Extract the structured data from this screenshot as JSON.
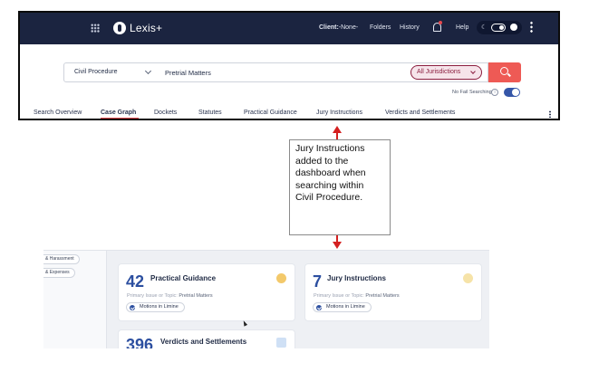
{
  "top_screen": {
    "nav": {
      "logo": "Lexis+",
      "client_label": "Client:",
      "client_value": "-None-",
      "folders": "Folders",
      "history": "History",
      "help": "Help"
    },
    "search": {
      "scope": "Civil Procedure",
      "query": "Pretrial Matters",
      "jurisdiction": "All Jurisdictions",
      "no_fail_label": "No Fail Searching",
      "no_fail_enabled": true
    },
    "tabs": [
      {
        "label": "Search Overview"
      },
      {
        "label": "Case Graph",
        "active": true
      },
      {
        "label": "Dockets"
      },
      {
        "label": "Statutes"
      },
      {
        "label": "Practical Guidance"
      },
      {
        "label": "Jury Instructions"
      },
      {
        "label": "Verdicts and Settlements"
      }
    ]
  },
  "callout": {
    "text": "Jury Instructions added to the dashboard when searching within Civil Procedure."
  },
  "bottom_screen": {
    "side_chips": [
      "& Harassment",
      "& Expenses"
    ],
    "cards": [
      {
        "count": "42",
        "title": "Practical Guidance",
        "meta_label": "Primary Issue or Topic:",
        "meta_value": "Pretrial Matters",
        "chip": "Motions in Limine",
        "icon": "book-icon",
        "icon_color": "#f3c96b"
      },
      {
        "count": "7",
        "title": "Jury Instructions",
        "meta_label": "Primary Issue or Topic:",
        "meta_value": "Pretrial Matters",
        "chip": "Motions in Limine",
        "icon": "pencil-icon",
        "icon_color": "#f6e3a8"
      },
      {
        "count": "396",
        "title": "Verdicts and Settlements",
        "icon": "building-icon",
        "icon_color": "#cfe0f5"
      }
    ]
  },
  "colors": {
    "nav_bg": "#1b2440",
    "accent_red": "#ee5a55",
    "jurisdiction": "#8b1e3f",
    "count_blue": "#2c4fa0",
    "callout_arrow": "#d42020"
  }
}
